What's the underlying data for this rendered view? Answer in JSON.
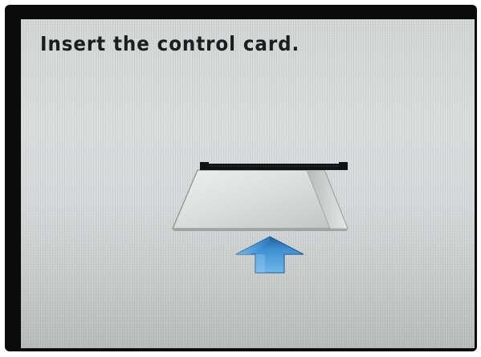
{
  "screen": {
    "message": "Insert the control card."
  },
  "icons": {
    "card_slot": "card-slot-icon",
    "control_card": "control-card-icon",
    "insert_arrow": "up-arrow-icon"
  },
  "colors": {
    "screen_background": "#d6dada",
    "text": "#1b1d1f",
    "arrow": "#2e7fc4",
    "bezel": "#0b0b0c"
  }
}
